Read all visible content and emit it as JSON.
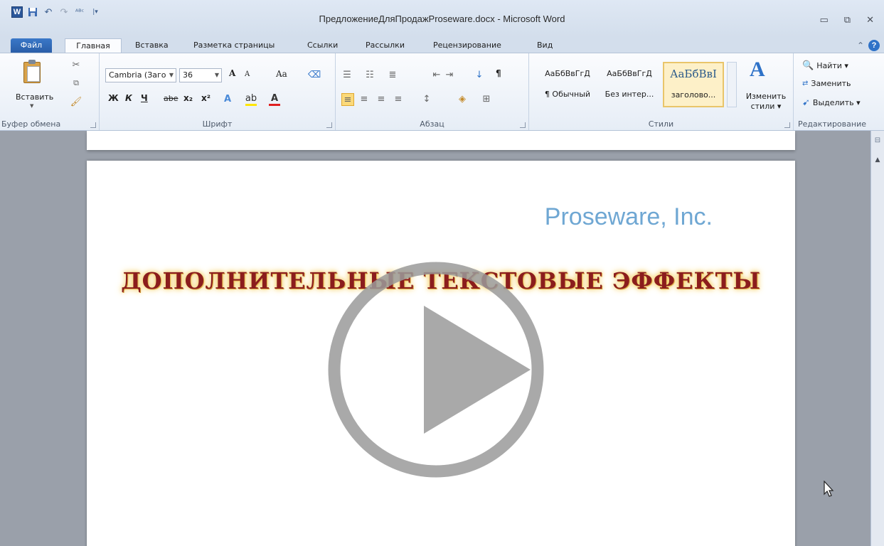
{
  "window": {
    "title": "ПредложениеДляПродажProseware.docx - Microsoft Word",
    "app_icon_letter": "W",
    "controls": [
      "minimize-icon",
      "restore-icon",
      "close-icon"
    ]
  },
  "quick_access": [
    "save-icon",
    "undo-icon",
    "redo-icon",
    "spelling-icon",
    "customize-qat-icon"
  ],
  "tabs": [
    "Файл",
    "Главная",
    "Вставка",
    "Разметка страницы",
    "Ссылки",
    "Рассылки",
    "Рецензирование",
    "Вид"
  ],
  "active_tab": "Главная",
  "ribbon": {
    "clipboard": {
      "label": "Буфер обмена",
      "paste_label": "Вставить"
    },
    "font": {
      "label": "Шрифт",
      "font_name": "Cambria (Заго",
      "font_size": "36",
      "grow": "A",
      "shrink": "A",
      "case": "Aa",
      "bold": "Ж",
      "italic": "К",
      "underline": "Ч",
      "strike": "abe",
      "subscript": "x₂",
      "superscript": "x²"
    },
    "paragraph": {
      "label": "Абзац",
      "pilcrow": "¶"
    },
    "styles": {
      "label": "Стили",
      "items": [
        {
          "sample": "АаБбВвГгД",
          "name": "¶ Обычный"
        },
        {
          "sample": "АаБбВвГгД",
          "name": "Без интер..."
        },
        {
          "sample": "АаБбВвI",
          "name": "заголово..."
        }
      ],
      "change_styles_line1": "Изменить",
      "change_styles_line2": "стили ▾"
    },
    "editing": {
      "label": "Редактирование",
      "find": "Найти ▾",
      "replace": "Заменить",
      "select": "Выделить ▾"
    }
  },
  "document": {
    "company": "Proseware, Inc.",
    "heading": "ДОПОЛНИТЕЛЬНЫЕ ТЕКСТОВЫЕ ЭФФЕКТЫ"
  },
  "overlay": {
    "type": "play-button",
    "color": "#9a9a9a"
  },
  "colors": {
    "accent": "#2b579a",
    "company_text": "#6fa7d3",
    "heading_text": "#8b1d1d",
    "heading_glow": "#f4c84a"
  }
}
